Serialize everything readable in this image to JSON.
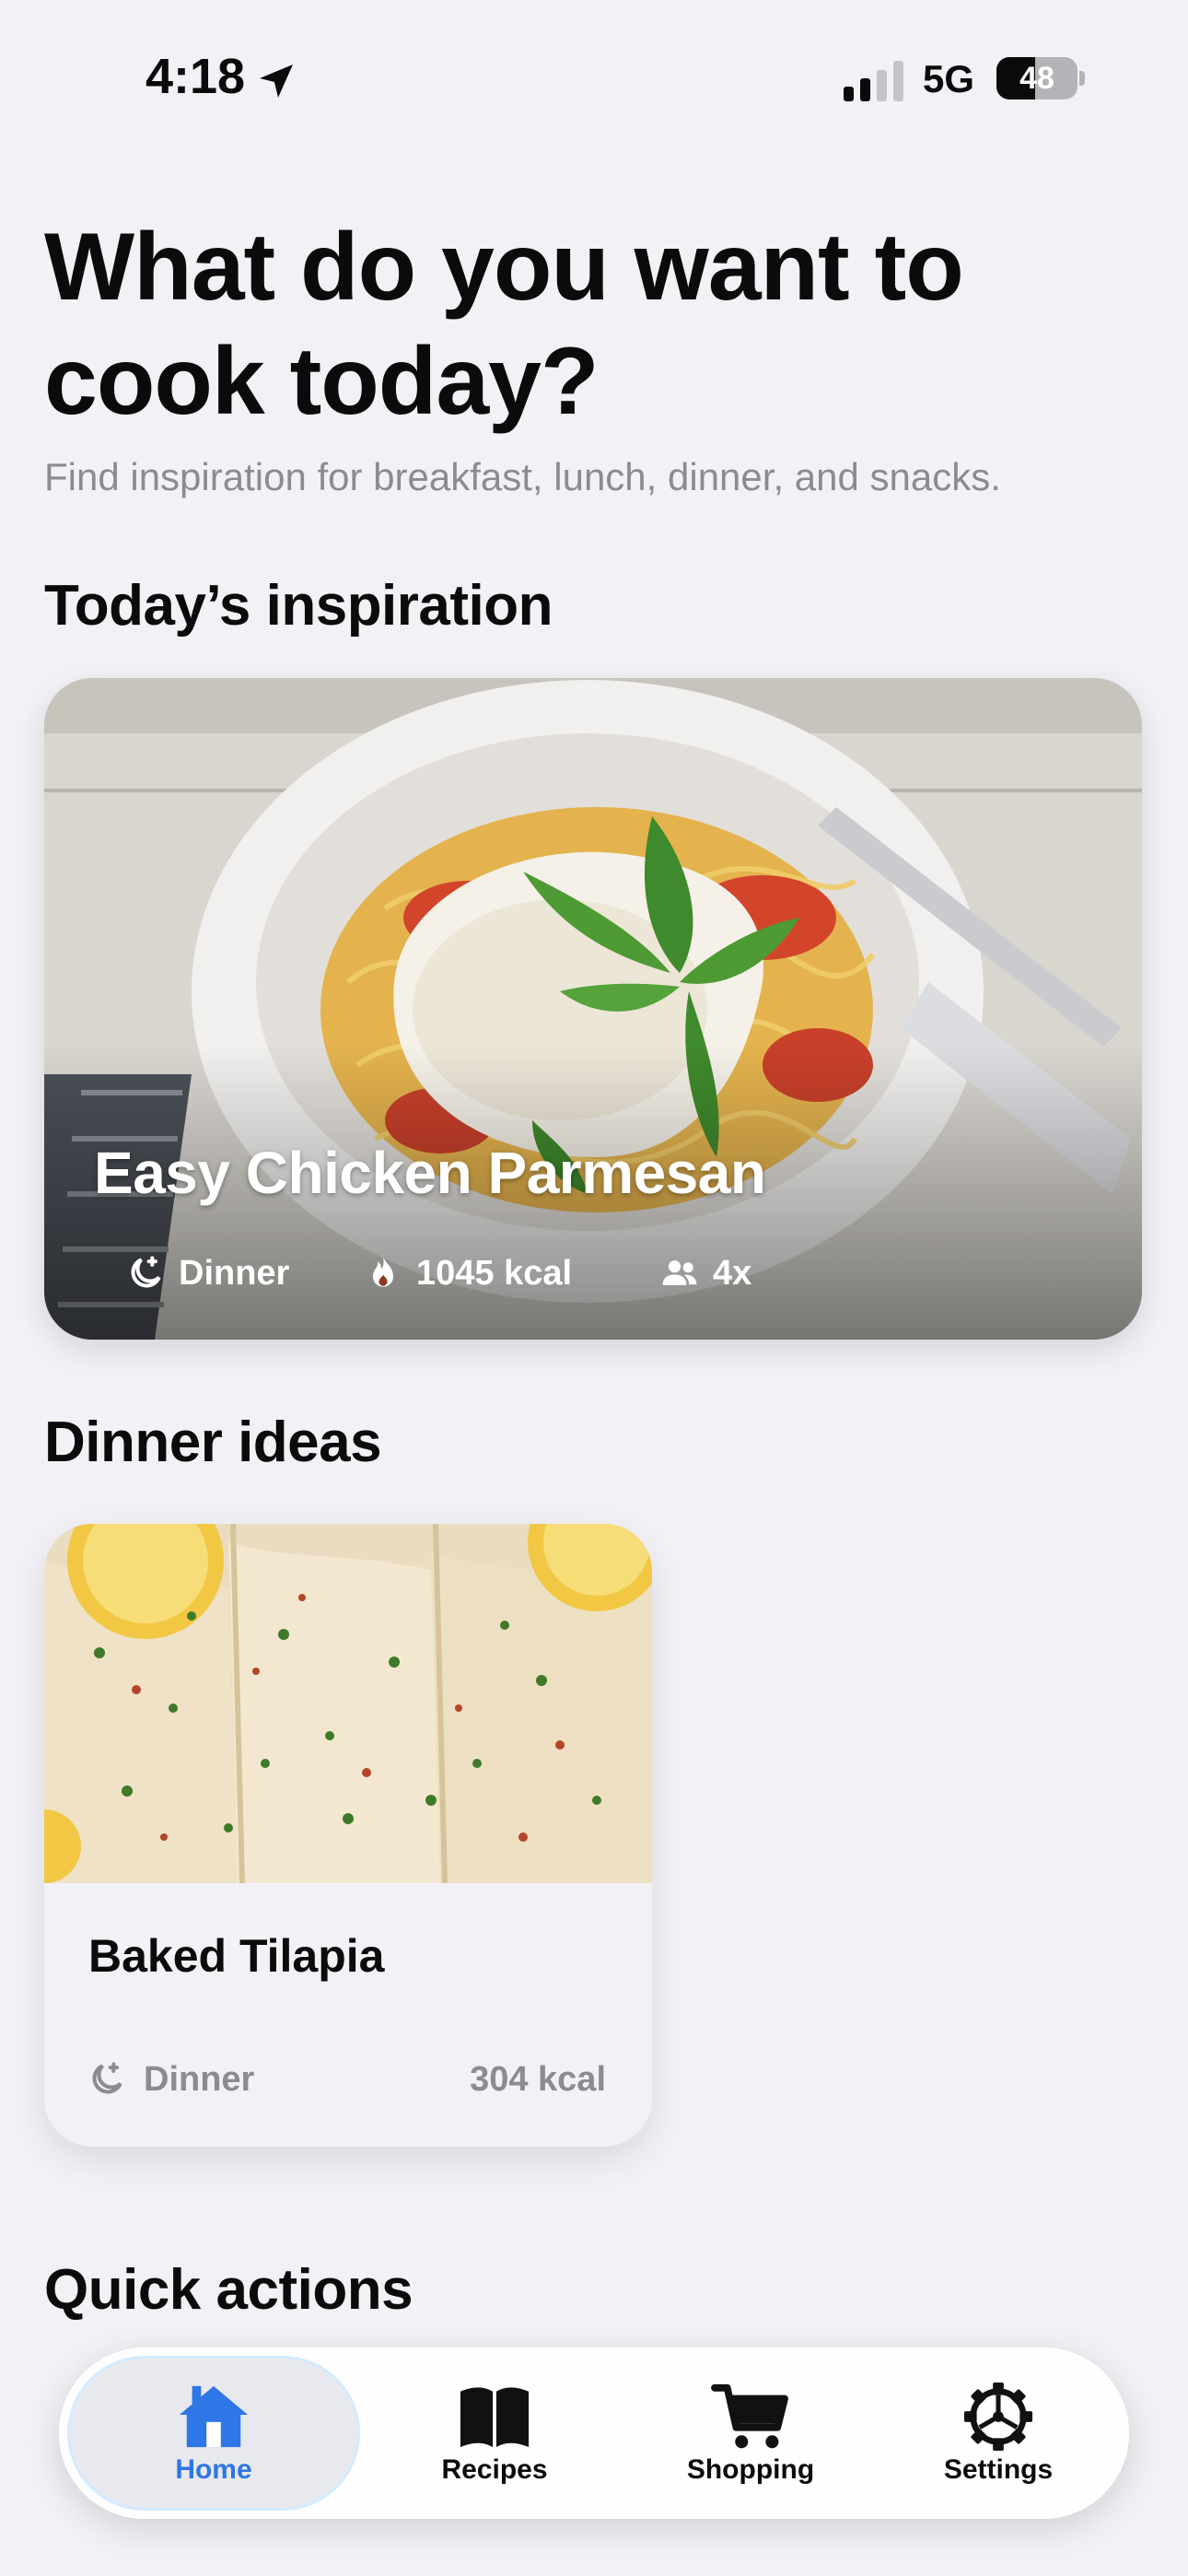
{
  "status_bar": {
    "time": "4:18",
    "network": "5G",
    "battery": "48",
    "battery_level": 0.48
  },
  "header": {
    "title": "What do you want to cook today?",
    "subtitle": "Find inspiration for breakfast, lunch, dinner, and snacks."
  },
  "inspiration": {
    "section_title": "Today’s inspiration",
    "recipe": {
      "name": "Easy Chicken Parmesan",
      "category": "Dinner",
      "calories": "1045 kcal",
      "servings": "4x"
    }
  },
  "dinner_ideas": {
    "section_title": "Dinner ideas",
    "cards": [
      {
        "name": "Baked Tilapia",
        "category": "Dinner",
        "calories": "304 kcal"
      }
    ]
  },
  "quick_actions": {
    "section_title": "Quick actions"
  },
  "tab_bar": {
    "tabs": [
      {
        "label": "Home",
        "icon": "house-icon",
        "active": true
      },
      {
        "label": "Recipes",
        "icon": "book-icon",
        "active": false
      },
      {
        "label": "Shopping",
        "icon": "cart-icon",
        "active": false
      },
      {
        "label": "Settings",
        "icon": "gear-icon",
        "active": false
      }
    ]
  },
  "colors": {
    "background": "#f2f1f6",
    "accent": "#2f76e6",
    "secondary_text": "#8b8b90"
  }
}
